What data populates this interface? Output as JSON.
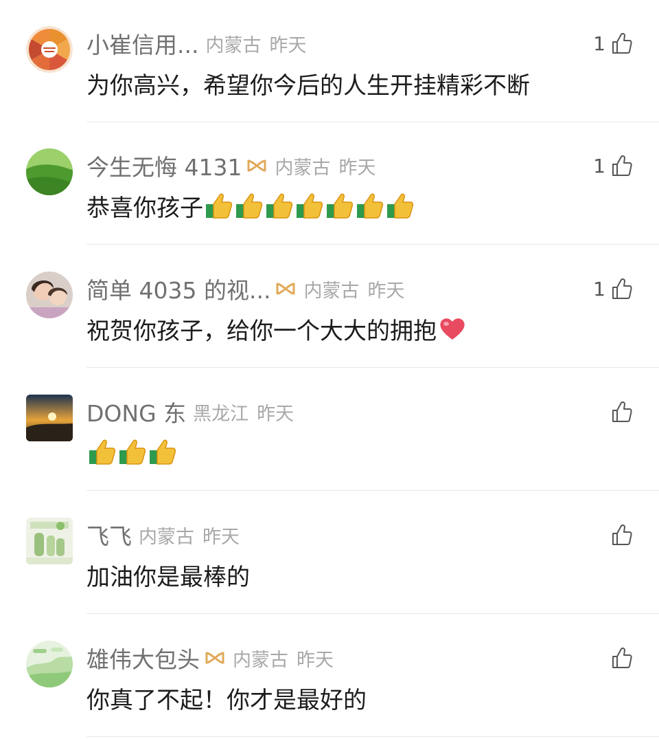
{
  "comments": [
    {
      "user": "小崔信用...",
      "vip": false,
      "region": "内蒙古",
      "time": "昨天",
      "text": "为你高兴，希望你今后的人生开挂精彩不断",
      "emoji": [],
      "likes": "1",
      "avatar": "pie-chart-avatar"
    },
    {
      "user": "今生无悔 4131",
      "vip": true,
      "region": "内蒙古",
      "time": "昨天",
      "text": "恭喜你孩子",
      "emoji": [
        "thumbs-up",
        "thumbs-up",
        "thumbs-up",
        "thumbs-up",
        "thumbs-up",
        "thumbs-up",
        "thumbs-up"
      ],
      "likes": "1",
      "avatar": "green-hill-avatar"
    },
    {
      "user": "简单 4035 的视...",
      "vip": true,
      "region": "内蒙古",
      "time": "昨天",
      "text": "祝贺你孩子，给你一个大大的拥抱",
      "emoji": [
        "red-heart"
      ],
      "likes": "1",
      "avatar": "selfie-avatar"
    },
    {
      "user": "DONG 东",
      "vip": false,
      "region": "黑龙江",
      "time": "昨天",
      "text": "",
      "emoji": [
        "thumbs-up",
        "thumbs-up",
        "thumbs-up"
      ],
      "likes": "",
      "avatar": "sunrise-avatar"
    },
    {
      "user": "飞飞",
      "vip": false,
      "region": "内蒙古",
      "time": "昨天",
      "text": "加油你是最棒的",
      "emoji": [],
      "likes": "",
      "avatar": "family-poster-avatar"
    },
    {
      "user": "雄伟大包头",
      "vip": true,
      "region": "内蒙古",
      "time": "昨天",
      "text": "你真了不起！你才是最好的",
      "emoji": [],
      "likes": "",
      "avatar": "green-map-avatar"
    }
  ],
  "colors": {
    "name": "#707070",
    "meta": "#a8a8a8",
    "text": "#1c1c1c",
    "vip_badge": "#e1a95a",
    "divider": "#e8e8e8"
  },
  "icons": {
    "like": "thumb-up-outline-icon",
    "vip": "infinity-badge-icon"
  }
}
